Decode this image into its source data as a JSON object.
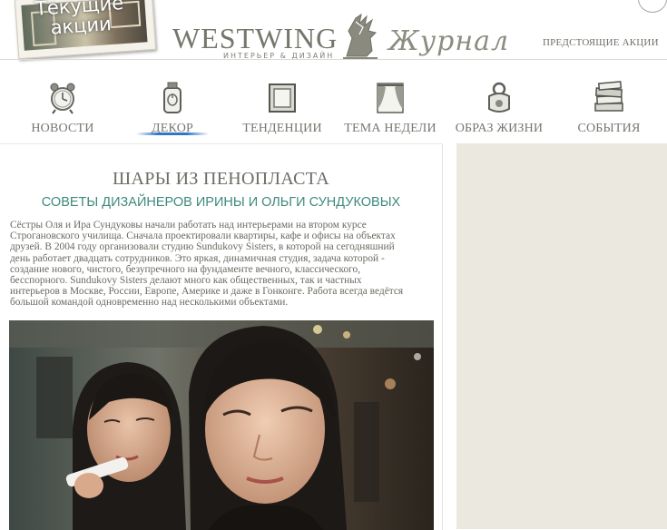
{
  "header": {
    "promo_card_label": "Текущие акции",
    "logo_wordmark": "WESTWING",
    "logo_tagline": "ИНТЕРЬЕР & ДИЗАЙН",
    "logo_journal": "Журнал",
    "upcoming_link": "ПРЕДСТОЯЩИЕ АКЦИИ"
  },
  "nav": {
    "active": "ДЕКОР",
    "items": [
      {
        "label": "НОВОСТИ",
        "icon": "alarm-clock-icon"
      },
      {
        "label": "ДЕКОР",
        "icon": "candle-jar-icon"
      },
      {
        "label": "ТЕНДЕНЦИИ",
        "icon": "picture-frame-icon"
      },
      {
        "label": "ТЕМА НЕДЕЛИ",
        "icon": "curtain-stage-icon"
      },
      {
        "label": "ОБРАЗ ЖИЗНИ",
        "icon": "ring-bag-icon"
      },
      {
        "label": "СОБЫТИЯ",
        "icon": "books-stack-icon"
      }
    ]
  },
  "article": {
    "title": "ШАРЫ ИЗ ПЕНОПЛАСТА",
    "subtitle": "СОВЕТЫ ДИЗАЙНЕРОВ ИРИНЫ И ОЛЬГИ СУНДУКОВЫХ",
    "body_lines": [
      "Сёстры Оля и Ира Сундуковы начали работать над интерьерами на втором курсе",
      "Строгановского училища. Сначала проектировали квартиры, кафе и офисы на объектах",
      "друзей. В 2004 году организовали студию Sundukovy Sisters, в которой на сегодняшний",
      "день работает двадцать сотрудников. Это яркая, динамичная студия, задача которой -",
      "создание нового, чистого, безупречного на фундаменте вечного, классического,",
      "бесспорного. Sundukovy Sisters делают много как общественных, так и частных",
      "интерьеров в Москве, России, Европе, Америке и даже в Гонконге. Работа всегда ведётся",
      "большой командой одновременно над несколькими объектами."
    ]
  },
  "colors": {
    "accent_teal": "#3d8a7c",
    "nav_underline": "#2f78c8",
    "sidebar_bg": "#ebe9df"
  }
}
